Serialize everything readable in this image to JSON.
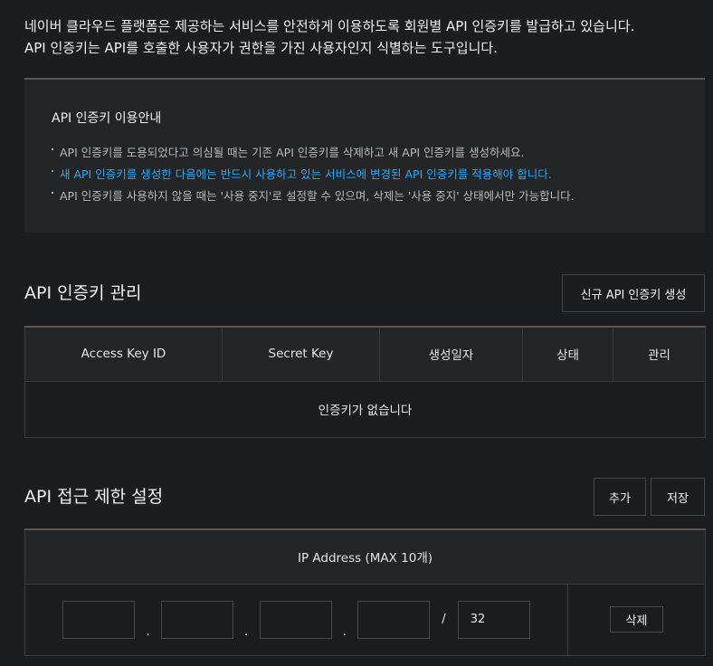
{
  "intro": {
    "line1": "네이버 클라우드 플랫폼은 제공하는 서비스를 안전하게 이용하도록 회원별 API 인증키를 발급하고 있습니다.",
    "line2": "API 인증키는 API를 호출한 사용자가 권한을 가진 사용자인지 식별하는 도구입니다."
  },
  "guide": {
    "title": "API 인증키 이용안내",
    "items": [
      "API 인증키를 도용되었다고 의심될 때는 기존 API 인증키를 삭제하고 새 API 인증키를 생성하세요.",
      "새 API 인증키를 생성한 다음에는 반드시 사용하고 있는 서비스에 변경된 API 인증키를 적용해야 합니다.",
      "API 인증키를 사용하지 않을 때는 '사용 중지'로 설정할 수 있으며, 삭제는 '사용 중지' 상태에서만 가능합니다."
    ],
    "highlight_color": "#2fa8f5"
  },
  "key_section": {
    "title": "API 인증키 관리",
    "create_button": "신규 API 인증키 생성",
    "columns": [
      "Access Key ID",
      "Secret Key",
      "생성일자",
      "상태",
      "관리"
    ],
    "empty_message": "인증키가 없습니다"
  },
  "ip_section": {
    "title": "API 접근 제한 설정",
    "add_button": "추가",
    "save_button": "저장",
    "column": "IP Address (MAX 10개)",
    "separator": ".",
    "slash": "/",
    "prefix_value": "32",
    "delete_button": "삭제"
  }
}
